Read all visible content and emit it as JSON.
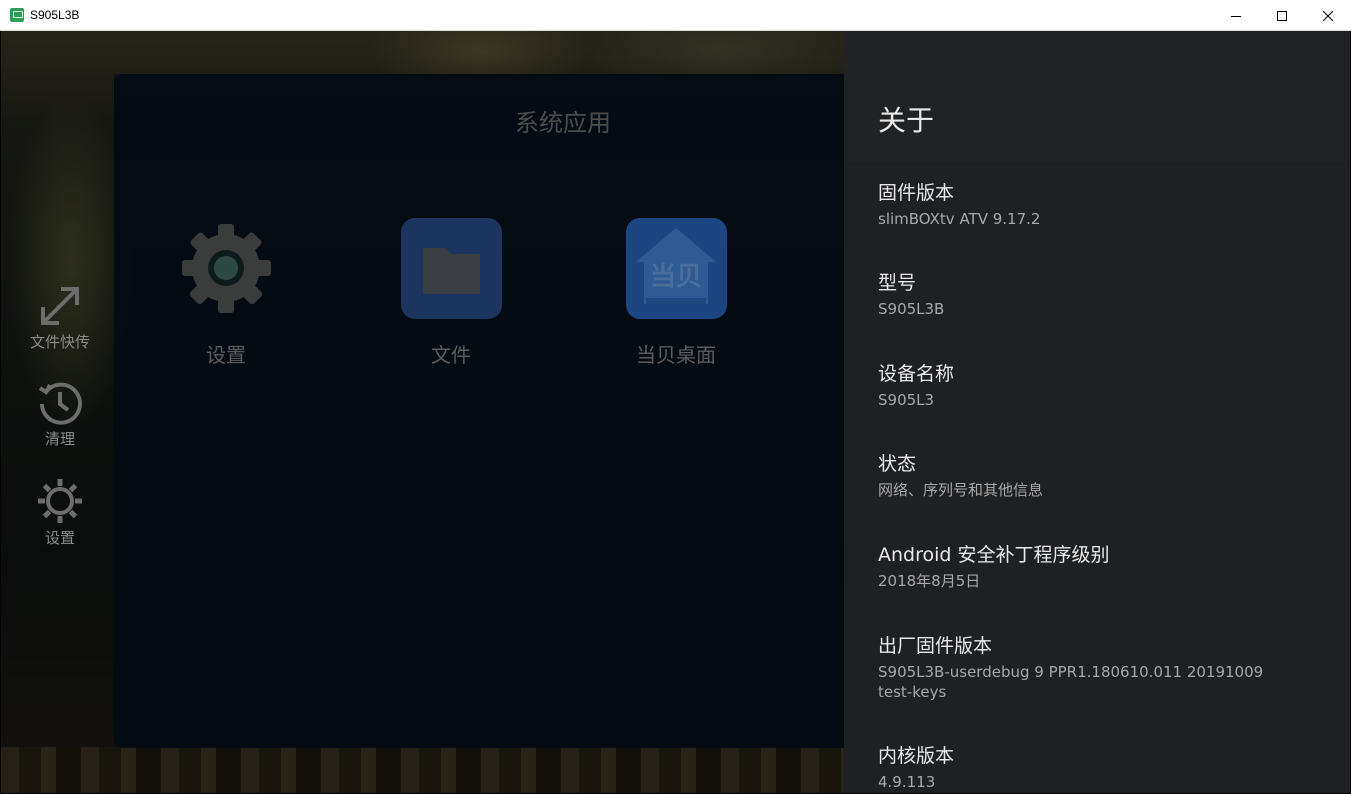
{
  "window": {
    "title": "S905L3B"
  },
  "side_rail": {
    "items": [
      {
        "label": "文件快传",
        "icon": "transfer-arrows-icon"
      },
      {
        "label": "清理",
        "icon": "clean-timer-icon"
      },
      {
        "label": "设置",
        "icon": "gear-icon"
      }
    ]
  },
  "panel": {
    "title": "系统应用",
    "apps": [
      {
        "label": "设置",
        "icon": "settings-gear-icon"
      },
      {
        "label": "文件",
        "icon": "folder-icon"
      },
      {
        "label": "当贝桌面",
        "icon": "dangbei-home-icon",
        "icon_text": "当贝"
      }
    ]
  },
  "settings": {
    "title": "关于",
    "items": [
      {
        "title": "固件版本",
        "value": "slimBOXtv ATV 9.17.2"
      },
      {
        "title": "型号",
        "value": "S905L3B"
      },
      {
        "title": "设备名称",
        "value": "S905L3"
      },
      {
        "title": "状态",
        "value": "网络、序列号和其他信息"
      },
      {
        "title": "Android 安全补丁程序级别",
        "value": "2018年8月5日"
      },
      {
        "title": "出厂固件版本",
        "value": "S905L3B-userdebug 9 PPR1.180610.011 20191009",
        "value2": "test-keys"
      },
      {
        "title": "内核版本",
        "value": "4.9.113"
      }
    ]
  },
  "colors": {
    "settings_bg": "#1f2022",
    "panel_bg": "#040a14",
    "folder_tile": "#1e3a66",
    "dangbei_tile": "#1c4a8a"
  }
}
